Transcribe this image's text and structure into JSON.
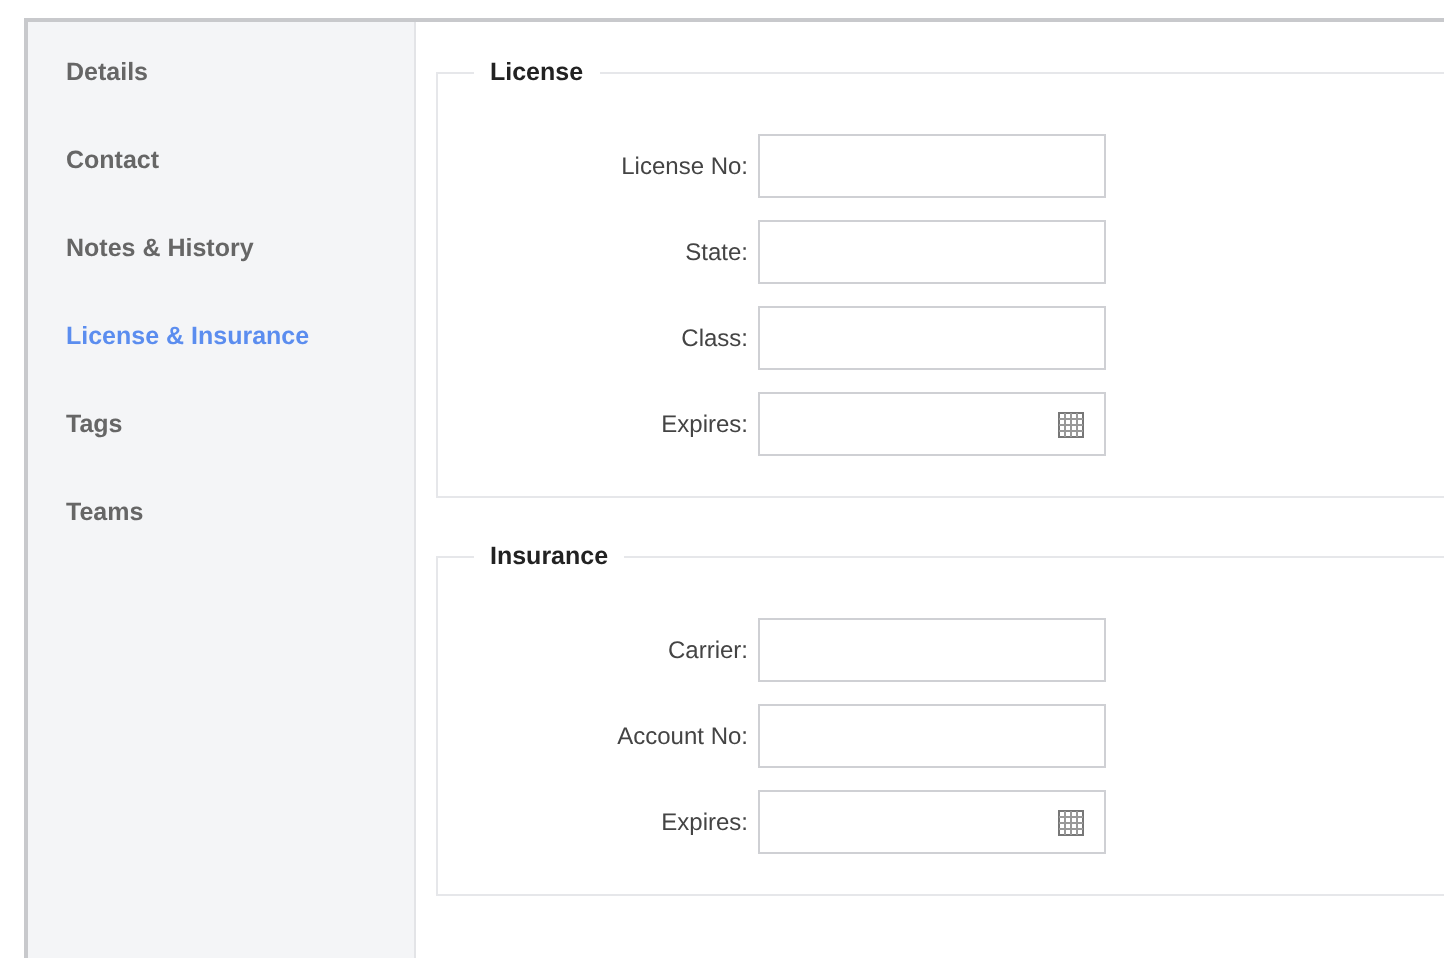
{
  "sidebar": {
    "items": [
      {
        "label": "Details",
        "selected": false
      },
      {
        "label": "Contact",
        "selected": false
      },
      {
        "label": "Notes & History",
        "selected": false
      },
      {
        "label": "License & Insurance",
        "selected": true
      },
      {
        "label": "Tags",
        "selected": false
      },
      {
        "label": "Teams",
        "selected": false
      }
    ]
  },
  "sections": [
    {
      "legend": "License",
      "fields": [
        {
          "label": "License No:",
          "kind": "text"
        },
        {
          "label": "State:",
          "kind": "text"
        },
        {
          "label": "Class:",
          "kind": "text"
        },
        {
          "label": "Expires:",
          "kind": "date"
        }
      ]
    },
    {
      "legend": "Insurance",
      "fields": [
        {
          "label": "Carrier:",
          "kind": "text"
        },
        {
          "label": "Account No:",
          "kind": "text"
        },
        {
          "label": "Expires:",
          "kind": "date"
        }
      ]
    }
  ]
}
